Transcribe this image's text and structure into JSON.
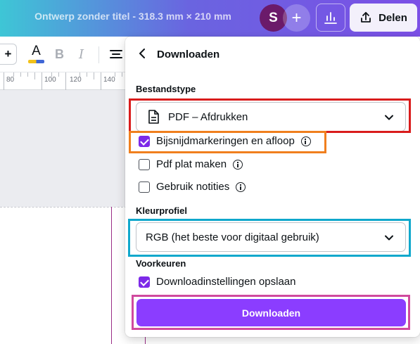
{
  "header": {
    "document_title": "Ontwerp zonder titel - 318.3 mm × 210 mm",
    "avatar_initial": "S",
    "add_collaborator_glyph": "+",
    "insights_icon": "bar-chart-icon",
    "share_label": "Delen",
    "share_icon": "upload-icon"
  },
  "toolbar": {
    "add_glyph": "+",
    "text_color_glyph": "A",
    "bold_glyph": "B",
    "italic_glyph": "I",
    "align_icon": "align-icon"
  },
  "ruler": {
    "labels": [
      "80",
      "100",
      "120",
      "140"
    ]
  },
  "download_panel": {
    "title": "Downloaden",
    "back_icon": "chevron-left-icon",
    "file_type": {
      "label": "Bestandstype",
      "value": "PDF – Afdrukken",
      "icon": "document-icon"
    },
    "options": [
      {
        "label": "Bijsnijdmarkeringen en afloop",
        "checked": true
      },
      {
        "label": "Pdf plat maken",
        "checked": false
      },
      {
        "label": "Gebruik notities",
        "checked": false
      }
    ],
    "color_profile": {
      "label": "Kleurprofiel",
      "value": "RGB (het beste voor digitaal gebruik)"
    },
    "preferences": {
      "label": "Voorkeuren",
      "save_settings_label": "Downloadinstellingen opslaan",
      "save_settings_checked": true
    },
    "download_button_label": "Downloaden"
  },
  "colors": {
    "accent": "#8b3dff",
    "checkbox": "#7d2ae8",
    "highlight_red": "#d91c1c",
    "highlight_orange": "#f07f1e",
    "highlight_cyan": "#10a8cc",
    "highlight_pink": "#d04a9e"
  }
}
